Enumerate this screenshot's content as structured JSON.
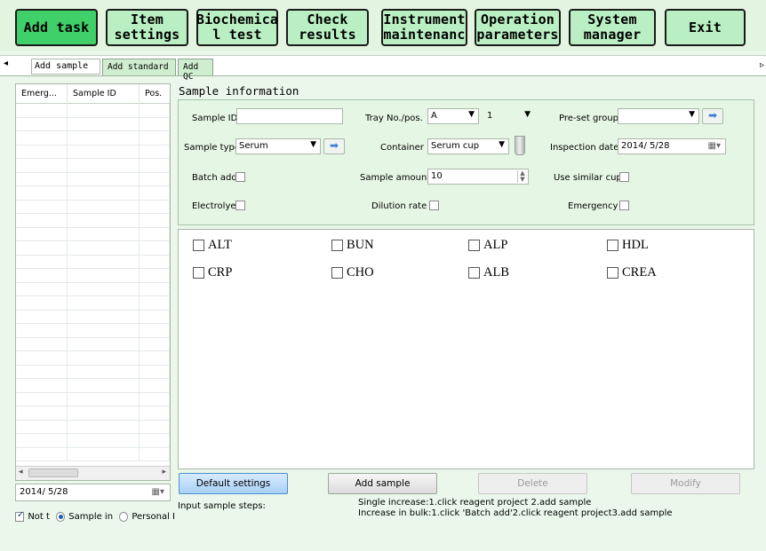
{
  "toolbar": {
    "buttons": [
      {
        "label": "Add task",
        "active": true
      },
      {
        "label": "Item\nsettings",
        "active": false
      },
      {
        "label": "Biochemica\nl test",
        "active": false
      },
      {
        "label": "Check\nresults",
        "active": false
      },
      {
        "label": "Instrument\nmaintenanc",
        "active": false
      },
      {
        "label": "Operation\nparameters",
        "active": false
      },
      {
        "label": "System\nmanager",
        "active": false
      },
      {
        "label": "Exit",
        "active": false
      }
    ]
  },
  "tabs": [
    {
      "label": "Add sample",
      "selected": true
    },
    {
      "label": "Add standard",
      "selected": false
    },
    {
      "label": "Add QC",
      "selected": false
    }
  ],
  "sample_list": {
    "columns": [
      "Emerg...",
      "Sample ID",
      "Pos."
    ],
    "rows": []
  },
  "left_footer": {
    "date": "2014/ 5/28",
    "not_checkbox_label": "Not t",
    "radio_sample_label": "Sample in",
    "radio_personal_label": "Personal I"
  },
  "sample_info": {
    "title": "Sample information",
    "sample_id_label": "Sample ID",
    "sample_id_value": "",
    "tray_label": "Tray No./pos.",
    "tray_value": "A",
    "pos_value": "1",
    "preset_label": "Pre-set group",
    "preset_value": "",
    "sample_type_label": "Sample type",
    "sample_type_value": "Serum",
    "container_label": "Container",
    "container_value": "Serum cup",
    "inspection_date_label": "Inspection date",
    "inspection_date_value": "2014/ 5/28",
    "batch_add_label": "Batch add",
    "sample_amount_label": "Sample amount",
    "sample_amount_value": "10",
    "similar_cup_label": "Use similar cup",
    "electrolyte_label": "Electrolye",
    "dilution_label": "Dilution rate",
    "emergency_label": "Emergency"
  },
  "items": [
    "ALT",
    "BUN",
    "ALP",
    "HDL",
    "CRP",
    "CHO",
    "ALB",
    "CREA"
  ],
  "actions": {
    "default_settings": "Default settings",
    "add_sample": "Add sample",
    "delete": "Delete",
    "modify": "Modify"
  },
  "instructions": {
    "steps_label": "Input sample steps:",
    "single": "Single increase:1.click reagent project 2.add sample",
    "bulk": "Increase in bulk:1.click 'Batch add'2.click reagent project3.add sample"
  }
}
